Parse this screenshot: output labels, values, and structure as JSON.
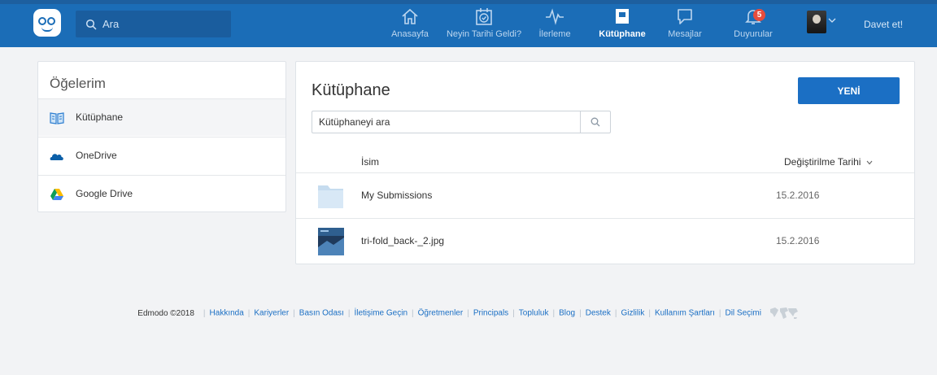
{
  "topbar": {
    "search_placeholder": "Ara",
    "nav": [
      {
        "label": "Anasayfa",
        "icon": "home-icon"
      },
      {
        "label": "Neyin Tarihi Geldi?",
        "icon": "calendar-check-icon"
      },
      {
        "label": "İlerleme",
        "icon": "pulse-icon"
      },
      {
        "label": "Kütüphane",
        "icon": "library-icon",
        "active": true
      },
      {
        "label": "Mesajlar",
        "icon": "chat-icon"
      },
      {
        "label": "Duyurular",
        "icon": "bell-icon"
      }
    ],
    "notification_count": "5",
    "invite_label": "Davet et!",
    "colors": {
      "bar": "#1b6db7",
      "active": "#ffffff",
      "inactive": "#bcd6ef"
    }
  },
  "sidebar": {
    "title": "Öğelerim",
    "items": [
      {
        "label": "Kütüphane",
        "icon": "book-icon"
      },
      {
        "label": "OneDrive",
        "icon": "onedrive-icon"
      },
      {
        "label": "Google Drive",
        "icon": "google-drive-icon"
      }
    ]
  },
  "main": {
    "title": "Kütüphane",
    "new_button": "YENİ",
    "search_placeholder": "Kütüphaneyi ara",
    "columns": {
      "name": "İsim",
      "date": "Değiştirilme Tarihi"
    },
    "rows": [
      {
        "name": "My Submissions",
        "date": "15.2.2016",
        "icon": "folder-icon"
      },
      {
        "name": "tri-fold_back-_2.jpg",
        "date": "15.2.2016",
        "icon": "image-thumbnail"
      }
    ]
  },
  "footer": {
    "copyright": "Edmodo ©2018",
    "links": [
      "Hakkında",
      "Kariyerler",
      "Basın Odası",
      "İletişime Geçin",
      "Öğretmenler",
      "Principals",
      "Topluluk",
      "Blog",
      "Destek",
      "Gizlilik",
      "Kullanım Şartları",
      "Dil Seçimi"
    ]
  }
}
